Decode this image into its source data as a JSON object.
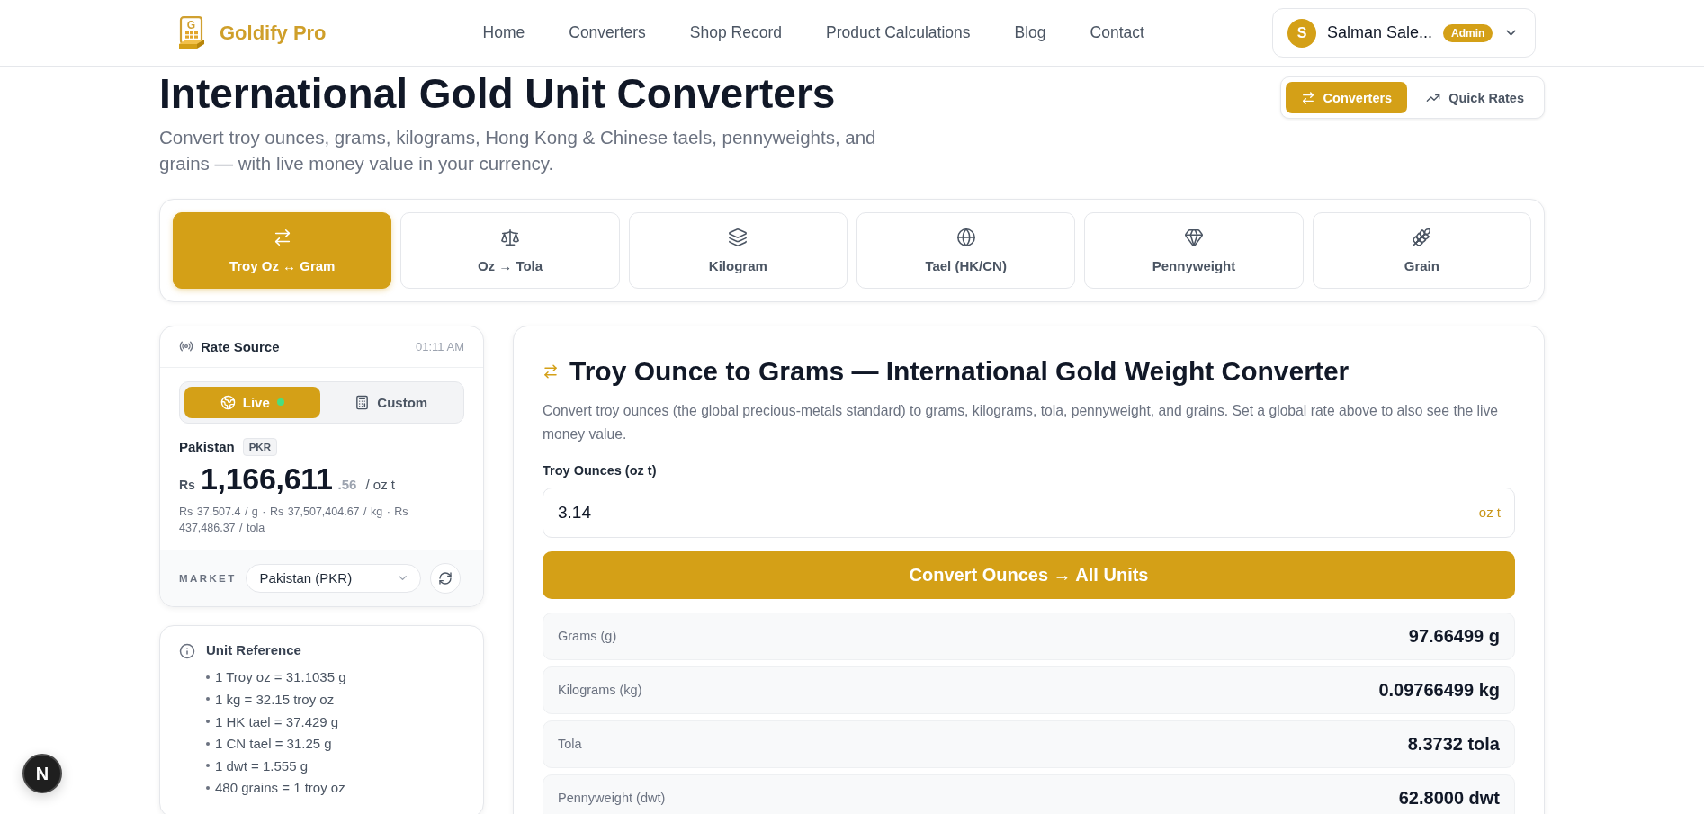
{
  "header": {
    "logo_letter": "G",
    "brand": "Goldify Pro",
    "nav": [
      {
        "label": "Home"
      },
      {
        "label": "Converters"
      },
      {
        "label": "Shop Record"
      },
      {
        "label": "Product Calculations"
      },
      {
        "label": "Blog"
      },
      {
        "label": "Contact"
      }
    ],
    "user": {
      "initial": "S",
      "name": "Salman Sale...",
      "role": "Admin"
    }
  },
  "page": {
    "title": "International Gold Unit Converters",
    "subtitle": "Convert troy ounces, grams, kilograms, Hong Kong & Chinese taels, pennyweights, and grains — with live money value in your currency.",
    "view_toggle": [
      {
        "label": "Converters",
        "selected": true
      },
      {
        "label": "Quick Rates",
        "selected": false
      }
    ]
  },
  "converter_tabs": [
    {
      "label": "Troy Oz ↔ Gram",
      "selected": true
    },
    {
      "label": "Oz → Tola",
      "selected": false
    },
    {
      "label": "Kilogram",
      "selected": false
    },
    {
      "label": "Tael (HK/CN)",
      "selected": false
    },
    {
      "label": "Pennyweight",
      "selected": false
    },
    {
      "label": "Grain",
      "selected": false
    }
  ],
  "rate_source": {
    "title": "Rate Source",
    "time": "01:11 AM",
    "modes": [
      {
        "kind": "live",
        "label": "Live",
        "selected": true
      },
      {
        "kind": "custom",
        "label": "Custom",
        "selected": false
      }
    ],
    "country": "Pakistan",
    "currency": "PKR",
    "price": {
      "symbol": "Rs",
      "whole": "1,166,611",
      "fraction": ".56",
      "unit": "/ oz t"
    },
    "breakdown": "Rs 37,507.4 / g · Rs 37,507,404.67 / kg · Rs 437,486.37 / tola",
    "market_label": "MARKET",
    "market_value": "Pakistan (PKR)"
  },
  "unit_reference": {
    "title": "Unit Reference",
    "items": [
      "1 Troy oz = 31.1035 g",
      "1 kg = 32.15 troy oz",
      "1 HK tael = 37.429 g",
      "1 CN tael = 31.25 g",
      "1 dwt = 1.555 g",
      "480 grains = 1 troy oz"
    ]
  },
  "converter": {
    "title": "Troy Ounce to Grams — International Gold Weight Converter",
    "description": "Convert troy ounces (the global precious-metals standard) to grams, kilograms, tola, pennyweight, and grains. Set a global rate above to also see the live money value.",
    "field_label": "Troy Ounces (oz t)",
    "value": "3.14",
    "unit": "oz t",
    "button": "Convert Ounces → All Units",
    "results": [
      {
        "label": "Grams (g)",
        "value": "97.66499 g"
      },
      {
        "label": "Kilograms (kg)",
        "value": "0.09766499 kg"
      },
      {
        "label": "Tola",
        "value": "8.3732 tola"
      },
      {
        "label": "Pennyweight (dwt)",
        "value": "62.8000 dwt"
      }
    ]
  },
  "dev_badge": {
    "label": "N"
  }
}
